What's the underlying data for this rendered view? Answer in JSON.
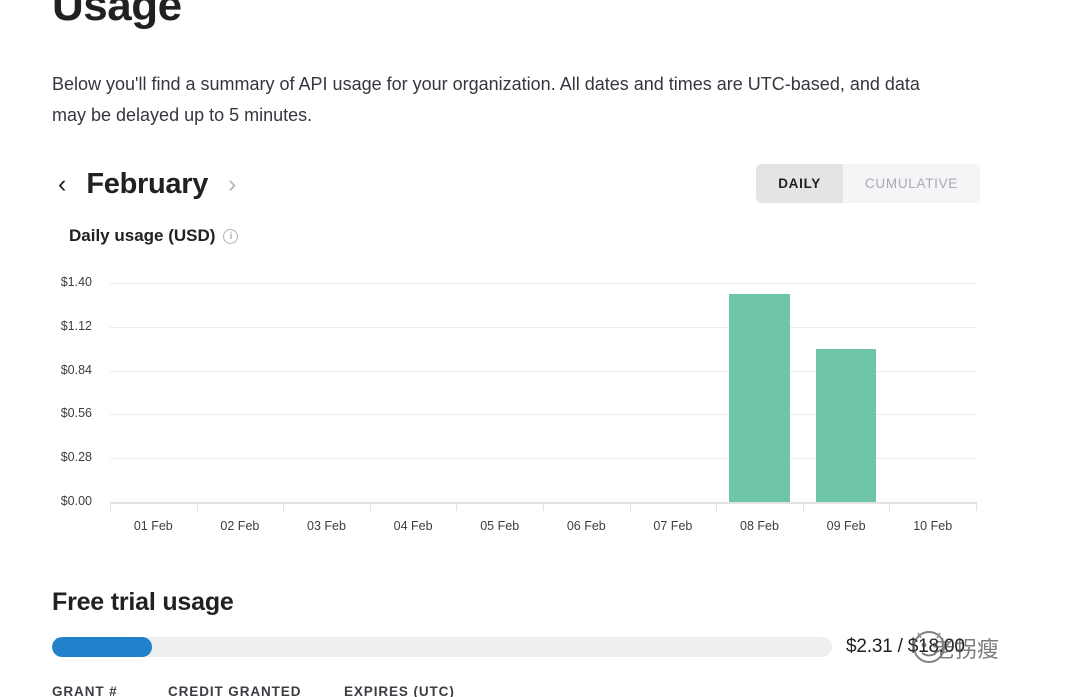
{
  "header": {
    "title": "Usage",
    "description": "Below you'll find a summary of API usage for your organization. All dates and times are UTC-based, and data may be delayed up to 5 minutes."
  },
  "nav": {
    "prev_icon": "chevron-left-icon",
    "prev_glyph": "‹",
    "next_icon": "chevron-right-icon",
    "next_glyph": "›",
    "month": "February"
  },
  "toggle": {
    "daily_label": "DAILY",
    "cumulative_label": "CUMULATIVE",
    "active": "DAILY"
  },
  "chart_header": {
    "title": "Daily usage (USD)",
    "info_icon": "info-icon",
    "info_glyph": "i"
  },
  "chart_data": {
    "type": "bar",
    "title": "Daily usage (USD)",
    "xlabel": "",
    "ylabel": "",
    "categories": [
      "01 Feb",
      "02 Feb",
      "03 Feb",
      "04 Feb",
      "05 Feb",
      "06 Feb",
      "07 Feb",
      "08 Feb",
      "09 Feb",
      "10 Feb"
    ],
    "values": [
      0,
      0,
      0,
      0,
      0,
      0,
      0,
      1.33,
      0.98,
      0
    ],
    "ytick_labels": [
      "$1.40",
      "$1.12",
      "$0.84",
      "$0.56",
      "$0.28",
      "$0.00"
    ],
    "ytick_values": [
      1.4,
      1.12,
      0.84,
      0.56,
      0.28,
      0.0
    ],
    "ylim": [
      0,
      1.4
    ],
    "grid": true,
    "legend": false,
    "bar_color": "#6ec5a8"
  },
  "trial": {
    "title": "Free trial usage",
    "used": "$2.31",
    "total": "$18.00",
    "amount_text": "$2.31 / $18.00",
    "percent": 12.8,
    "fill_color": "#2080c9"
  },
  "table": {
    "headers": [
      "GRANT #",
      "CREDIT GRANTED",
      "EXPIRES (UTC)"
    ]
  },
  "watermark": {
    "text": "老拐瘦"
  }
}
